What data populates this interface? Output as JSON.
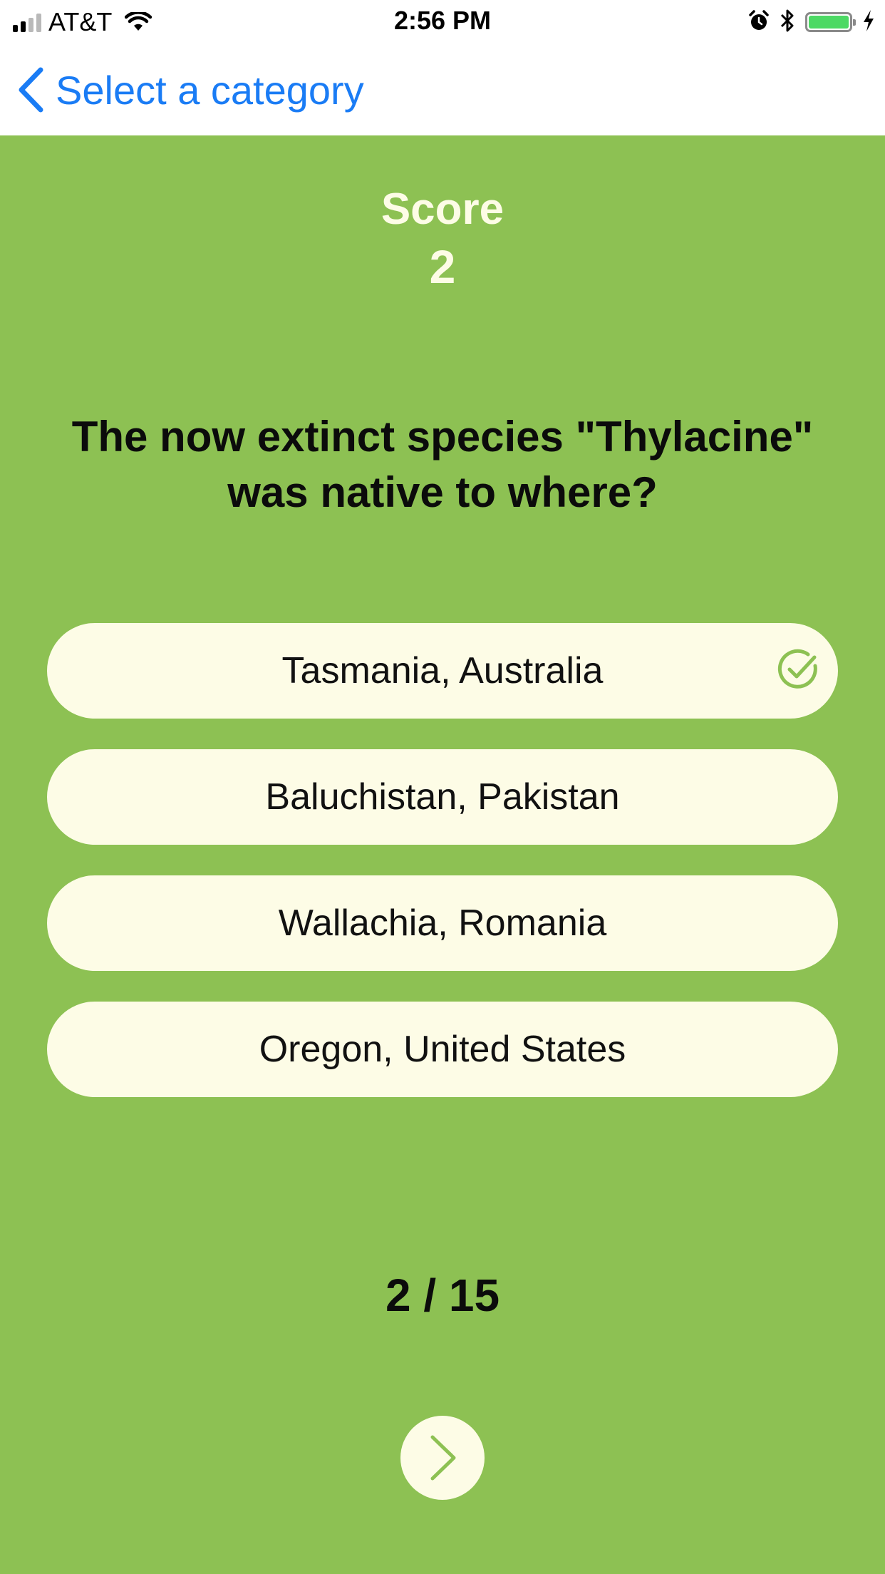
{
  "status_bar": {
    "carrier": "AT&T",
    "time": "2:56 PM",
    "icons": [
      "signal-icon",
      "wifi-icon",
      "alarm-icon",
      "bluetooth-icon",
      "battery-icon",
      "charging-icon"
    ]
  },
  "nav": {
    "back_label": "Select a category",
    "back_icon": "chevron-left-icon"
  },
  "quiz": {
    "score_label": "Score",
    "score_value": "2",
    "question": "The now extinct species \"Thylacine\" was native to where?",
    "answers": [
      {
        "label": "Tasmania, Australia",
        "correct": true,
        "icon": "check-circle-icon"
      },
      {
        "label": "Baluchistan, Pakistan"
      },
      {
        "label": "Wallachia, Romania"
      },
      {
        "label": "Oregon, United States"
      }
    ],
    "progress": "2 / 15",
    "next_icon": "chevron-right-icon"
  },
  "colors": {
    "background": "#8dc153",
    "answer_bg": "#fdfce6",
    "accent": "#1a7cf5",
    "battery": "#4cd964"
  }
}
